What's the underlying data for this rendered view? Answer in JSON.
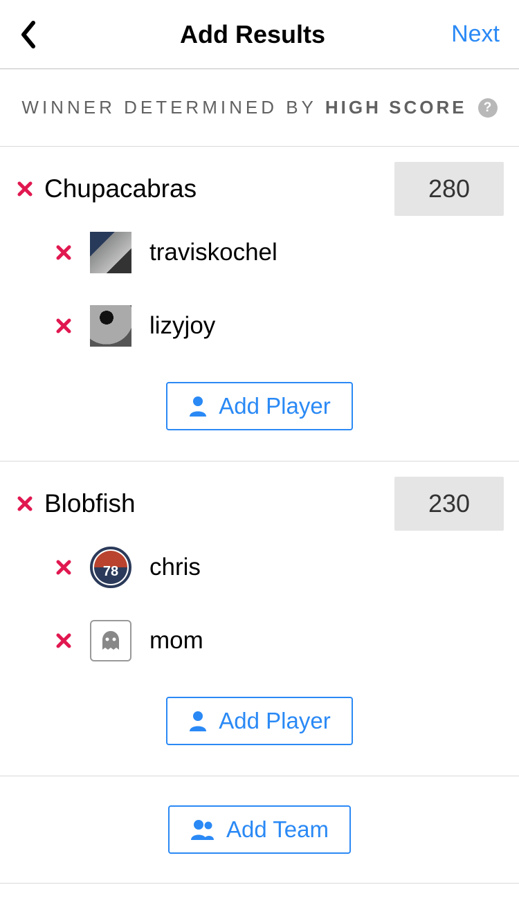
{
  "header": {
    "title": "Add Results",
    "next_label": "Next"
  },
  "winner_bar": {
    "prefix": "WINNER DETERMINED BY",
    "emphasis": "HIGH SCORE"
  },
  "teams": [
    {
      "name": "Chupacabras",
      "score": "280",
      "players": [
        {
          "name": "traviskochel",
          "avatar_kind": "photo1"
        },
        {
          "name": "lizyjoy",
          "avatar_kind": "photo2"
        }
      ]
    },
    {
      "name": "Blobfish",
      "score": "230",
      "players": [
        {
          "name": "chris",
          "avatar_kind": "circle78"
        },
        {
          "name": "mom",
          "avatar_kind": "ghost"
        }
      ]
    }
  ],
  "buttons": {
    "add_player": "Add Player",
    "add_team": "Add Team"
  }
}
